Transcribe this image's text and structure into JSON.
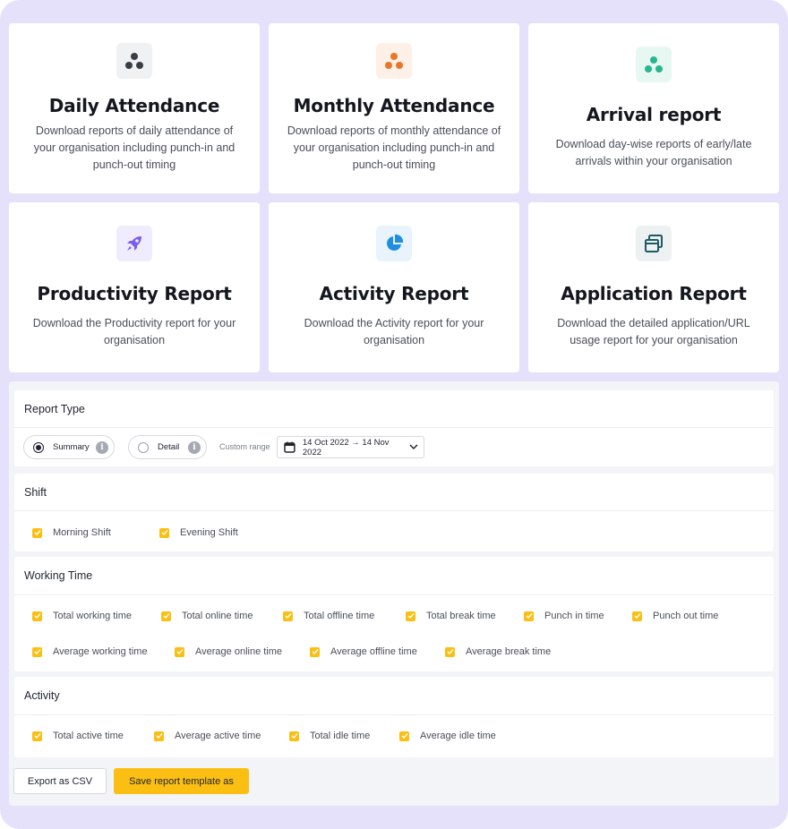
{
  "cards": [
    {
      "title": "Daily Attendance",
      "desc": "Download reports of daily attendance of your organisation including punch-in and punch-out timing",
      "icon": "three-dots-icon",
      "icon_bg": "#f0f1f3",
      "icon_color": "#3a3d45"
    },
    {
      "title": "Monthly Attendance",
      "desc": "Download reports of monthly attendance of your organisation including punch-in and punch-out timing",
      "icon": "three-dots-icon",
      "icon_bg": "#fdf0e6",
      "icon_color": "#e8762b"
    },
    {
      "title": "Arrival report",
      "desc": "Download day-wise reports of early/late arrivals within your organisation",
      "icon": "three-dots-icon",
      "icon_bg": "#e7f8f3",
      "icon_color": "#27b68d"
    },
    {
      "title": "Productivity Report",
      "desc": "Download the Productivity report for your organisation",
      "icon": "rocket-icon",
      "icon_bg": "#efecfd",
      "icon_color": "#7c5cf0"
    },
    {
      "title": "Activity Report",
      "desc": "Download the Activity report for your organisation",
      "icon": "pie-chart-icon",
      "icon_bg": "#e8f3fc",
      "icon_color": "#1f8ee0"
    },
    {
      "title": "Application Report",
      "desc": "Download the detailed application/URL usage report for your organisation",
      "icon": "windows-icon",
      "icon_bg": "#eef1f2",
      "icon_color": "#1f5a61"
    }
  ],
  "report_type": {
    "heading": "Report Type",
    "options": [
      {
        "label": "Summary",
        "selected": true
      },
      {
        "label": "Detail",
        "selected": false
      }
    ],
    "custom_range_label": "Custom range",
    "date_range": "14 Oct 2022 → 14 Nov 2022"
  },
  "shift": {
    "heading": "Shift",
    "items": [
      "Morning Shift",
      "Evening Shift"
    ]
  },
  "working_time": {
    "heading": "Working Time",
    "row1": [
      "Total working time",
      "Total online time",
      "Total offline time",
      "Total break time",
      "Punch in time",
      "Punch out time"
    ],
    "row2": [
      "Average working time",
      "Average online time",
      "Average offline time",
      "Average break time"
    ]
  },
  "activity": {
    "heading": "Activity",
    "items": [
      "Total active time",
      "Average active time",
      "Total idle time",
      "Average idle time"
    ]
  },
  "actions": {
    "export_label": "Export as CSV",
    "save_label": "Save report template as"
  },
  "colors": {
    "accent": "#fbbf14",
    "frame": "#e6e1fb"
  }
}
